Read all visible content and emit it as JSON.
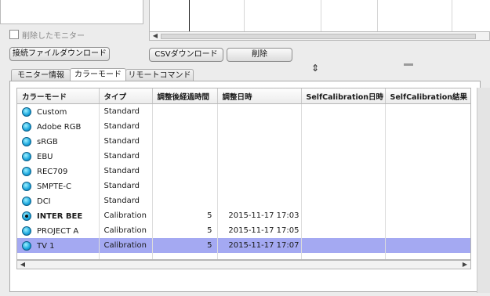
{
  "top": {
    "deleted_monitor_label": "削除したモニター",
    "download_connection_file_button": "接続ファイルダウンロード",
    "csv_download_button": "CSVダウンロード",
    "delete_button": "削除"
  },
  "tabs": [
    {
      "label": "モニター情報",
      "active": false
    },
    {
      "label": "カラーモード",
      "active": true
    },
    {
      "label": "リモートコマンド",
      "active": false
    }
  ],
  "table": {
    "headers": [
      "カラーモード",
      "タイプ",
      "調整後経過時間",
      "調整日時",
      "SelfCalibration日時",
      "SelfCalibration結果"
    ],
    "rows": [
      {
        "mode": "Custom",
        "type": "Standard",
        "elapsed": "",
        "date": "",
        "sc_date": "",
        "sc_result": "",
        "active": false,
        "selected": false
      },
      {
        "mode": "Adobe RGB",
        "type": "Standard",
        "elapsed": "",
        "date": "",
        "sc_date": "",
        "sc_result": "",
        "active": false,
        "selected": false
      },
      {
        "mode": "sRGB",
        "type": "Standard",
        "elapsed": "",
        "date": "",
        "sc_date": "",
        "sc_result": "",
        "active": false,
        "selected": false
      },
      {
        "mode": "EBU",
        "type": "Standard",
        "elapsed": "",
        "date": "",
        "sc_date": "",
        "sc_result": "",
        "active": false,
        "selected": false
      },
      {
        "mode": "REC709",
        "type": "Standard",
        "elapsed": "",
        "date": "",
        "sc_date": "",
        "sc_result": "",
        "active": false,
        "selected": false
      },
      {
        "mode": "SMPTE-C",
        "type": "Standard",
        "elapsed": "",
        "date": "",
        "sc_date": "",
        "sc_result": "",
        "active": false,
        "selected": false
      },
      {
        "mode": "DCI",
        "type": "Standard",
        "elapsed": "",
        "date": "",
        "sc_date": "",
        "sc_result": "",
        "active": false,
        "selected": false
      },
      {
        "mode": "INTER BEE",
        "type": "Calibration",
        "elapsed": "5",
        "date": "2015-11-17 17:03",
        "sc_date": "",
        "sc_result": "",
        "active": true,
        "selected": false
      },
      {
        "mode": "PROJECT A",
        "type": "Calibration",
        "elapsed": "5",
        "date": "2015-11-17 17:05",
        "sc_date": "",
        "sc_result": "",
        "active": false,
        "selected": false
      },
      {
        "mode": "TV 1",
        "type": "Calibration",
        "elapsed": "5",
        "date": "2015-11-17 17:07",
        "sc_date": "",
        "sc_result": "",
        "active": false,
        "selected": true
      }
    ]
  },
  "colors": {
    "selection": "#a4a9f2",
    "indicator": "#1aa6dd"
  }
}
